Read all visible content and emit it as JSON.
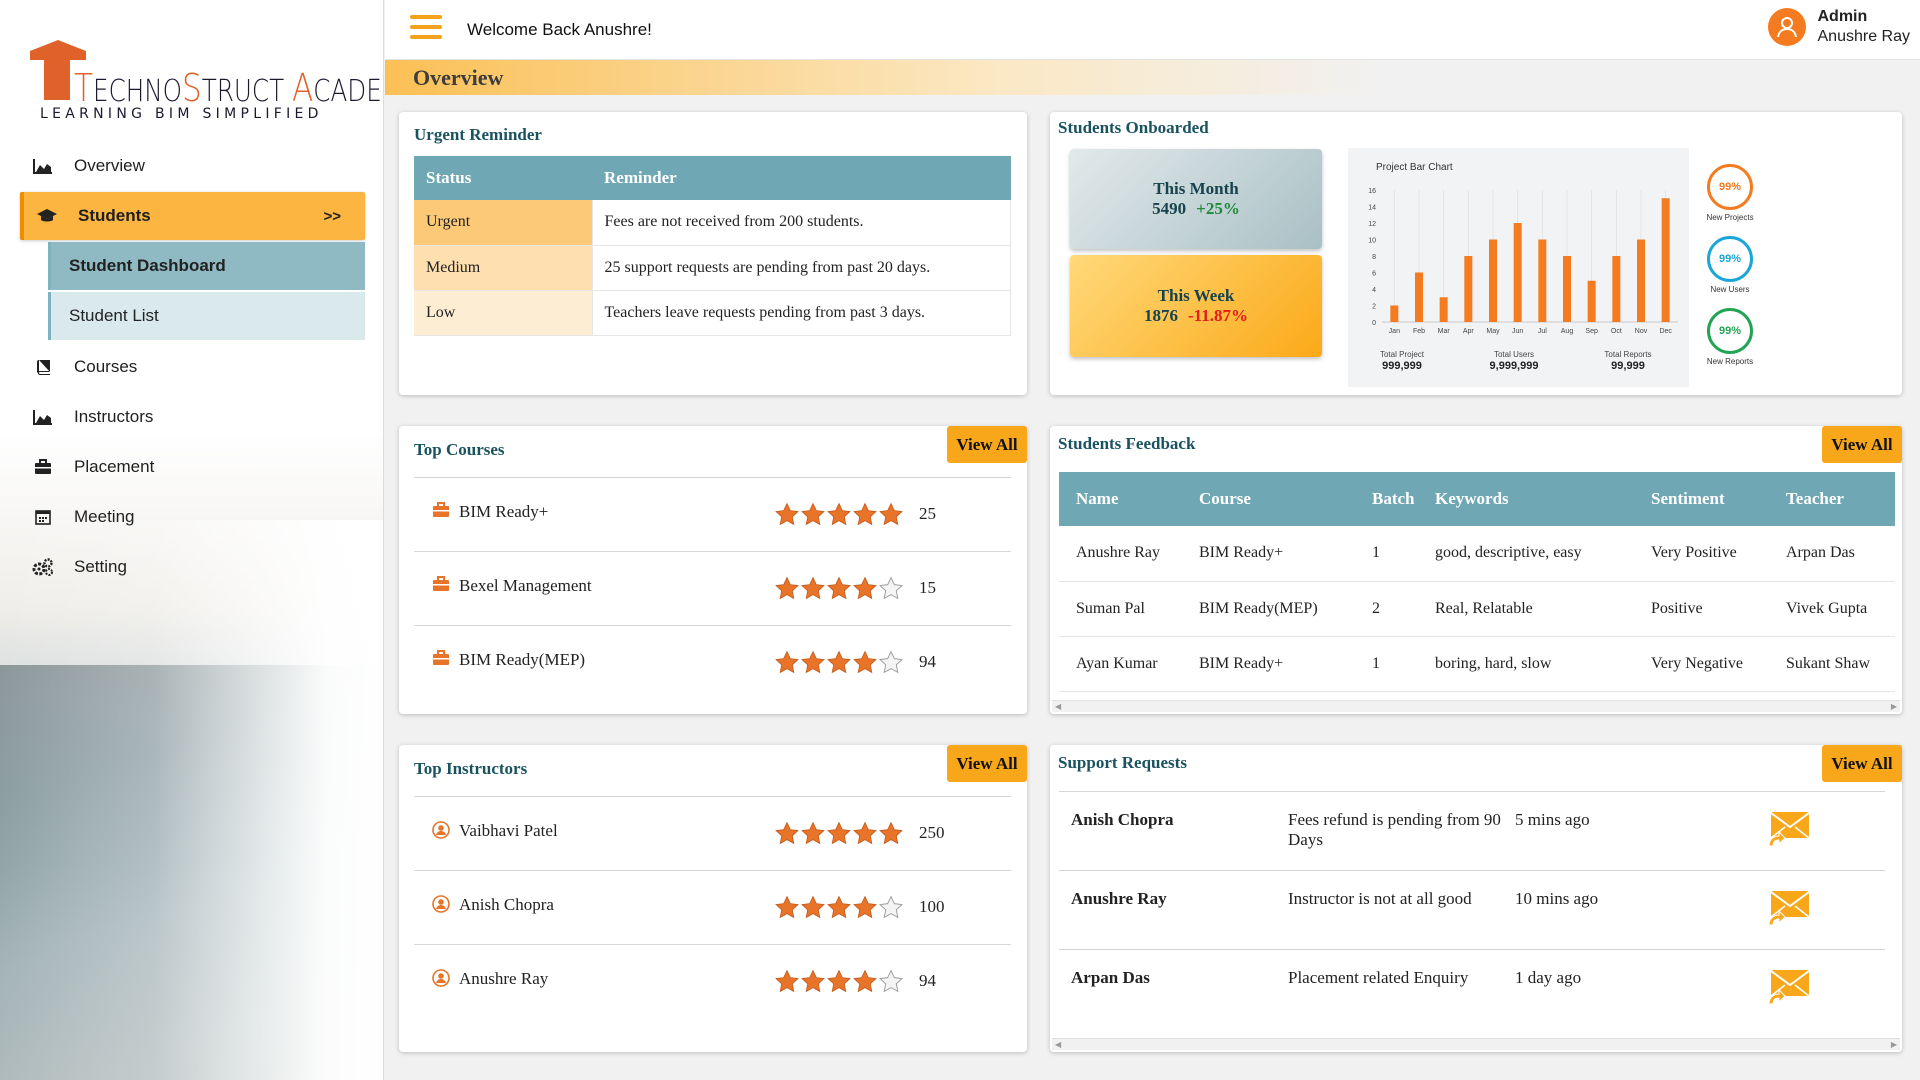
{
  "brand": {
    "logo_text": "TechnoStruct Academy",
    "tagline": "Learning BIM Simplified"
  },
  "sidebar": {
    "items": [
      {
        "label": "Overview",
        "icon": "area-chart-icon"
      },
      {
        "label": "Students",
        "icon": "graduation-cap-icon",
        "active": true,
        "chevron": ">>"
      },
      {
        "label": "Courses",
        "icon": "book-icon"
      },
      {
        "label": "Instructors",
        "icon": "area-chart-icon"
      },
      {
        "label": "Placement",
        "icon": "briefcase-icon"
      },
      {
        "label": "Meeting",
        "icon": "calendar-icon"
      },
      {
        "label": "Setting",
        "icon": "cogs-icon"
      }
    ],
    "subitems": [
      {
        "label": "Student Dashboard",
        "selected": true
      },
      {
        "label": "Student List"
      }
    ]
  },
  "header": {
    "welcome": "Welcome Back Anushre!",
    "user_role": "Admin",
    "user_name": "Anushre Ray"
  },
  "page_title": "Overview",
  "urgent_reminder": {
    "title": "Urgent Reminder",
    "columns": [
      "Status",
      "Reminder"
    ],
    "rows": [
      {
        "status": "Urgent",
        "reminder": "Fees are not received from 200 students."
      },
      {
        "status": "Medium",
        "reminder": "25 support requests are pending from past 20 days."
      },
      {
        "status": "Low",
        "reminder": "Teachers leave requests pending from past 3 days."
      }
    ]
  },
  "students_onboarded": {
    "title": "Students Onboarded",
    "this_month": {
      "label": "This Month",
      "value": "5490",
      "change": "+25%"
    },
    "this_week": {
      "label": "This Week",
      "value": "1876",
      "change": "-11.87%"
    },
    "chart_data": {
      "type": "bar",
      "title": "Project Bar Chart",
      "categories": [
        "Jan",
        "Feb",
        "Mar",
        "Apr",
        "May",
        "Jun",
        "Jul",
        "Aug",
        "Sep",
        "Oct",
        "Nov",
        "Dec"
      ],
      "values": [
        2,
        6,
        3,
        8,
        10,
        12,
        10,
        8,
        5,
        8,
        10,
        15
      ],
      "yticks": [
        "0",
        "2",
        "4",
        "6",
        "8",
        "10",
        "12",
        "14",
        "16"
      ],
      "ylim": [
        0,
        16
      ]
    },
    "totals": [
      {
        "label": "Total Project",
        "value": "999,999"
      },
      {
        "label": "Total Users",
        "value": "9,999,999"
      },
      {
        "label": "Total Reports",
        "value": "99,999"
      }
    ],
    "rings": [
      {
        "value": "99%",
        "label": "New Projects",
        "color": "#f47b20"
      },
      {
        "value": "99%",
        "label": "New Users",
        "color": "#1aa6d8"
      },
      {
        "value": "99%",
        "label": "New Reports",
        "color": "#23a455"
      }
    ]
  },
  "top_courses": {
    "title": "Top Courses",
    "view_all": "View All",
    "items": [
      {
        "name": "BIM Ready+",
        "rating": 5,
        "count": "25"
      },
      {
        "name": "Bexel Management",
        "rating": 4,
        "count": "15"
      },
      {
        "name": "BIM Ready(MEP)",
        "rating": 4,
        "count": "94"
      }
    ]
  },
  "students_feedback": {
    "title": "Students Feedback",
    "view_all": "View All",
    "columns": [
      "Name",
      "Course",
      "Batch",
      "Keywords",
      "Sentiment",
      "Teacher"
    ],
    "rows": [
      [
        "Anushre Ray",
        "BIM Ready+",
        "1",
        "good, descriptive, easy",
        "Very Positive",
        "Arpan Das"
      ],
      [
        "Suman Pal",
        "BIM Ready(MEP)",
        "2",
        "Real, Relatable",
        "Positive",
        "Vivek Gupta"
      ],
      [
        "Ayan Kumar",
        "BIM Ready+",
        "1",
        "boring, hard, slow",
        "Very Negative",
        "Sukant Shaw"
      ]
    ]
  },
  "top_instructors": {
    "title": "Top Instructors",
    "view_all": "View All",
    "items": [
      {
        "name": "Vaibhavi Patel",
        "rating": 5,
        "count": "250"
      },
      {
        "name": "Anish Chopra",
        "rating": 4,
        "count": "100"
      },
      {
        "name": "Anushre Ray",
        "rating": 4,
        "count": "94"
      }
    ]
  },
  "support_requests": {
    "title": "Support Requests",
    "view_all": "View All",
    "items": [
      {
        "name": "Anish Chopra",
        "message": "Fees refund is pending from 90 Days",
        "time": "5 mins ago"
      },
      {
        "name": "Anushre Ray",
        "message": "Instructor is not at all good",
        "time": "10 mins ago"
      },
      {
        "name": "Arpan Das",
        "message": "Placement related Enquiry",
        "time": "1 day ago"
      }
    ]
  },
  "colors": {
    "accent": "#f9a71a",
    "teal_header": "#6fa8b4",
    "title_text": "#1a5360",
    "bar": "#f47b20",
    "star": "#e8742a"
  }
}
